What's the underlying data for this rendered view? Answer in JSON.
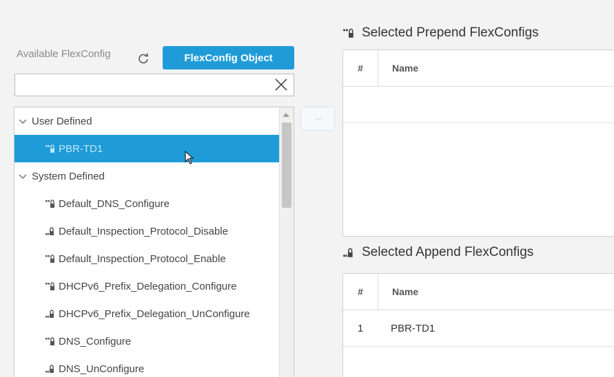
{
  "left": {
    "available_label": "Available FlexConfig",
    "object_button_label": "FlexConfig Object",
    "search": {
      "value": "",
      "placeholder": ""
    },
    "tree": {
      "groups": [
        {
          "label": "User Defined",
          "items": [
            {
              "label": "PBR-TD1",
              "icon": "prepend-config-icon",
              "selected": true
            }
          ]
        },
        {
          "label": "System Defined",
          "items": [
            {
              "label": "Default_DNS_Configure",
              "icon": "prepend-config-icon"
            },
            {
              "label": "Default_Inspection_Protocol_Disable",
              "icon": "append-config-icon"
            },
            {
              "label": "Default_Inspection_Protocol_Enable",
              "icon": "prepend-config-icon"
            },
            {
              "label": "DHCPv6_Prefix_Delegation_Configure",
              "icon": "prepend-config-icon"
            },
            {
              "label": "DHCPv6_Prefix_Delegation_UnConfigure",
              "icon": "append-config-icon"
            },
            {
              "label": "DNS_Configure",
              "icon": "prepend-config-icon"
            },
            {
              "label": "DNS_UnConfigure",
              "icon": "append-config-icon"
            }
          ]
        }
      ]
    }
  },
  "prepend": {
    "title": "Selected Prepend FlexConfigs",
    "columns": {
      "hash": "#",
      "name": "Name"
    },
    "rows": []
  },
  "append": {
    "title": "Selected Append FlexConfigs",
    "columns": {
      "hash": "#",
      "name": "Name"
    },
    "rows": [
      {
        "num": "1",
        "name": "PBR-TD1"
      }
    ]
  },
  "colors": {
    "accent": "#1f9cd8",
    "selected_text": "#bfe6f7",
    "background": "#f3f3f4"
  }
}
